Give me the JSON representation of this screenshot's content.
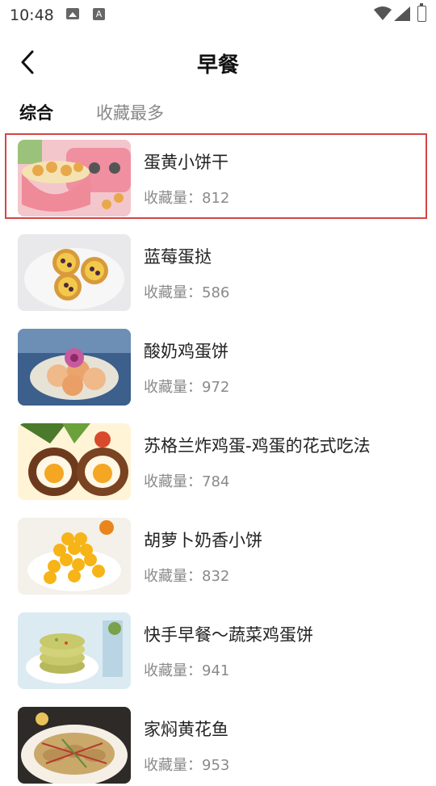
{
  "status_bar": {
    "time": "10:48",
    "notif_a": "A"
  },
  "header": {
    "title": "早餐"
  },
  "tabs": [
    {
      "label": "综合",
      "active": true
    },
    {
      "label": "收藏最多",
      "active": false
    }
  ],
  "favorites_label": "收藏量：",
  "recipes": [
    {
      "name": "蛋黄小饼干",
      "count": "812",
      "colors": [
        "#f3c6cc",
        "#f5e2b3",
        "#e8a84a"
      ],
      "selected": true
    },
    {
      "name": "蓝莓蛋挞",
      "count": "586",
      "colors": [
        "#e9e9ec",
        "#e9b54a",
        "#4b2a3c"
      ]
    },
    {
      "name": "酸奶鸡蛋饼",
      "count": "972",
      "colors": [
        "#3c5f8c",
        "#f0b98a",
        "#c65a9e"
      ]
    },
    {
      "name": "苏格兰炸鸡蛋-鸡蛋的花式吃法",
      "count": "784",
      "colors": [
        "#6e3a1e",
        "#f5a623",
        "#fff4d6"
      ]
    },
    {
      "name": "胡萝卜奶香小饼",
      "count": "832",
      "colors": [
        "#f4f0ea",
        "#f7b417",
        "#e8861c"
      ]
    },
    {
      "name": "快手早餐～蔬菜鸡蛋饼",
      "count": "941",
      "colors": [
        "#dcebf2",
        "#c7c96a",
        "#7aa14b"
      ]
    },
    {
      "name": "家焖黄花鱼",
      "count": "953",
      "colors": [
        "#f5efe6",
        "#c9a86a",
        "#b83a2c"
      ]
    }
  ]
}
